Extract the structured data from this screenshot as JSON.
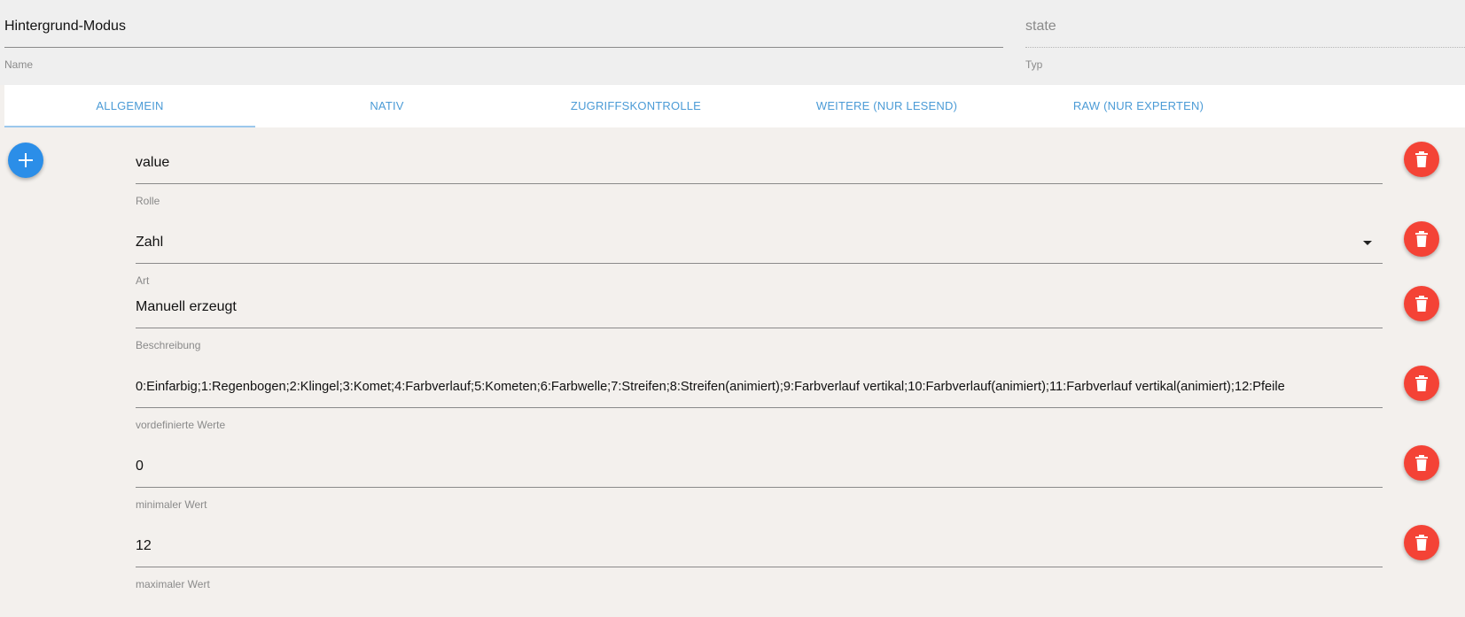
{
  "header": {
    "name_value": "Hintergrund-Modus",
    "name_label": "Name",
    "type_value": "state",
    "type_label": "Typ"
  },
  "tabs": [
    {
      "label": "ALLGEMEIN",
      "active": true
    },
    {
      "label": "NATIV",
      "active": false
    },
    {
      "label": "ZUGRIFFSKONTROLLE",
      "active": false
    },
    {
      "label": "WEITERE (NUR LESEND)",
      "active": false
    },
    {
      "label": "RAW (NUR EXPERTEN)",
      "active": false
    }
  ],
  "add_button": {
    "icon": "plus-icon"
  },
  "fields": [
    {
      "value": "value",
      "label": "Rolle"
    },
    {
      "value": "Zahl",
      "label": "Art",
      "dropdown": true
    },
    {
      "value": "Manuell erzeugt",
      "label": "Beschreibung"
    },
    {
      "value": "0:Einfarbig;1:Regenbogen;2:Klingel;3:Komet;4:Farbverlauf;5:Kometen;6:Farbwelle;7:Streifen;8:Streifen(animiert);9:Farbverlauf vertikal;10:Farbverlauf(animiert);11:Farbverlauf vertikal(animiert);12:Pfeile",
      "label": "vordefinierte Werte"
    },
    {
      "value": "0",
      "label": "minimaler Wert"
    },
    {
      "value": "12",
      "label": "maximaler Wert"
    }
  ],
  "delete_button": {
    "icon": "trash-icon"
  },
  "colors": {
    "accent": "#2b8ee8",
    "tab_text": "#4b9bd6",
    "delete": "#f44336",
    "background": "#f3f0ed"
  }
}
